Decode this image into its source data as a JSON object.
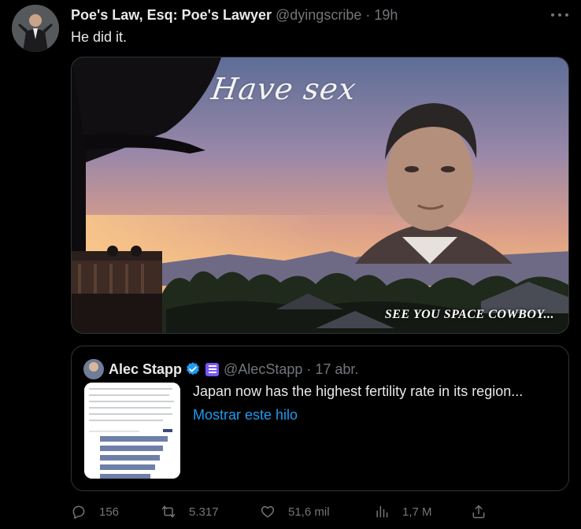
{
  "tweet": {
    "author_name": "Poe's Law, Esq: Poe's Lawyer",
    "handle": "@dyingscribe",
    "separator": "·",
    "time": "19h",
    "text": "He did it.",
    "more_icon": "more-horizontal-icon"
  },
  "media": {
    "overlay_top": "Have sex",
    "overlay_bottom": "SEE YOU SPACE COWBOY..."
  },
  "quoted": {
    "author_name": "Alec Stapp",
    "verified_icon": "verified-badge-icon",
    "subscription_icon": "subscription-badge-icon",
    "handle": "@AlecStapp",
    "separator": "·",
    "date": "17 abr.",
    "text": "Japan now has the highest fertility rate in its region...",
    "link": "Mostrar este hilo"
  },
  "actions": {
    "replies": "156",
    "reposts": "5.317",
    "likes": "51,6 mil",
    "views": "1,7 M"
  },
  "colors": {
    "background": "#000000",
    "text": "#e7e9ea",
    "muted": "#71767b",
    "accent": "#1d9bf0",
    "border": "#2f3336"
  }
}
